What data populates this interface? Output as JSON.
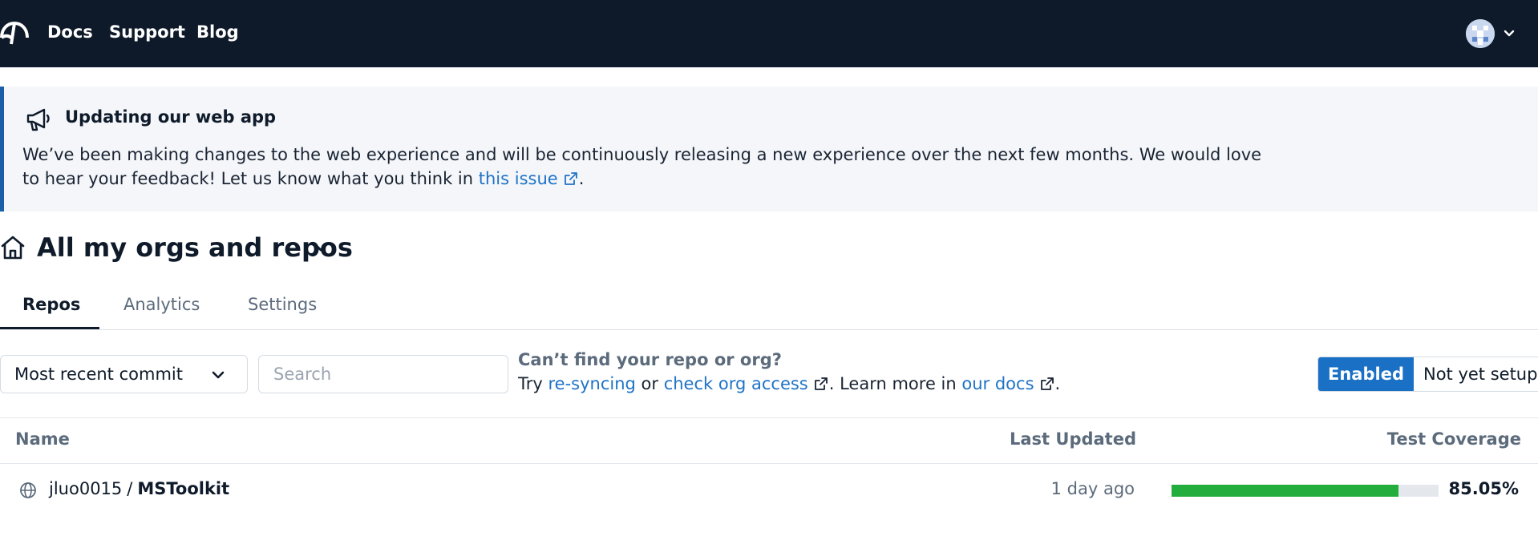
{
  "nav": {
    "links": [
      "Docs",
      "Support",
      "Blog"
    ]
  },
  "banner": {
    "title": "Updating our web app",
    "text_before": "We’ve been making changes to the web experience and will be continuously releasing a new experience over the next few months. We would love to hear your feedback! Let us know what you think in ",
    "link": "this issue",
    "text_after": "."
  },
  "page": {
    "title": "All my orgs and repos"
  },
  "tabs": [
    {
      "label": "Repos",
      "active": true
    },
    {
      "label": "Analytics",
      "active": false
    },
    {
      "label": "Settings",
      "active": false
    }
  ],
  "controls": {
    "sort_value": "Most recent commit",
    "search_placeholder": "Search",
    "help_title": "Can’t find your repo or org?",
    "help_try": "Try ",
    "help_link1": "re-syncing",
    "help_or": " or ",
    "help_link2": "check org access",
    "help_learn": ". Learn more in ",
    "help_link3": "our docs",
    "help_end": ".",
    "toggle_on": "Enabled",
    "toggle_off": "Not yet setup"
  },
  "table": {
    "columns": [
      "Name",
      "Last Updated",
      "Test Coverage"
    ],
    "rows": [
      {
        "owner": "jluo0015",
        "separator": "/",
        "name": "MSToolkit",
        "last_updated": "1 day ago",
        "coverage": "85.05%",
        "coverage_fraction": 0.8505
      }
    ]
  },
  "colors": {
    "nav_bg": "#0e1a2a",
    "accent": "#1a70c4",
    "link": "#1f73c6",
    "coverage_bar": "#22ad3d"
  },
  "icons": [
    "codecov-logo-icon",
    "avatar",
    "chevron-down-icon",
    "megaphone-icon",
    "external-link-icon",
    "home-icon",
    "globe-icon"
  ]
}
